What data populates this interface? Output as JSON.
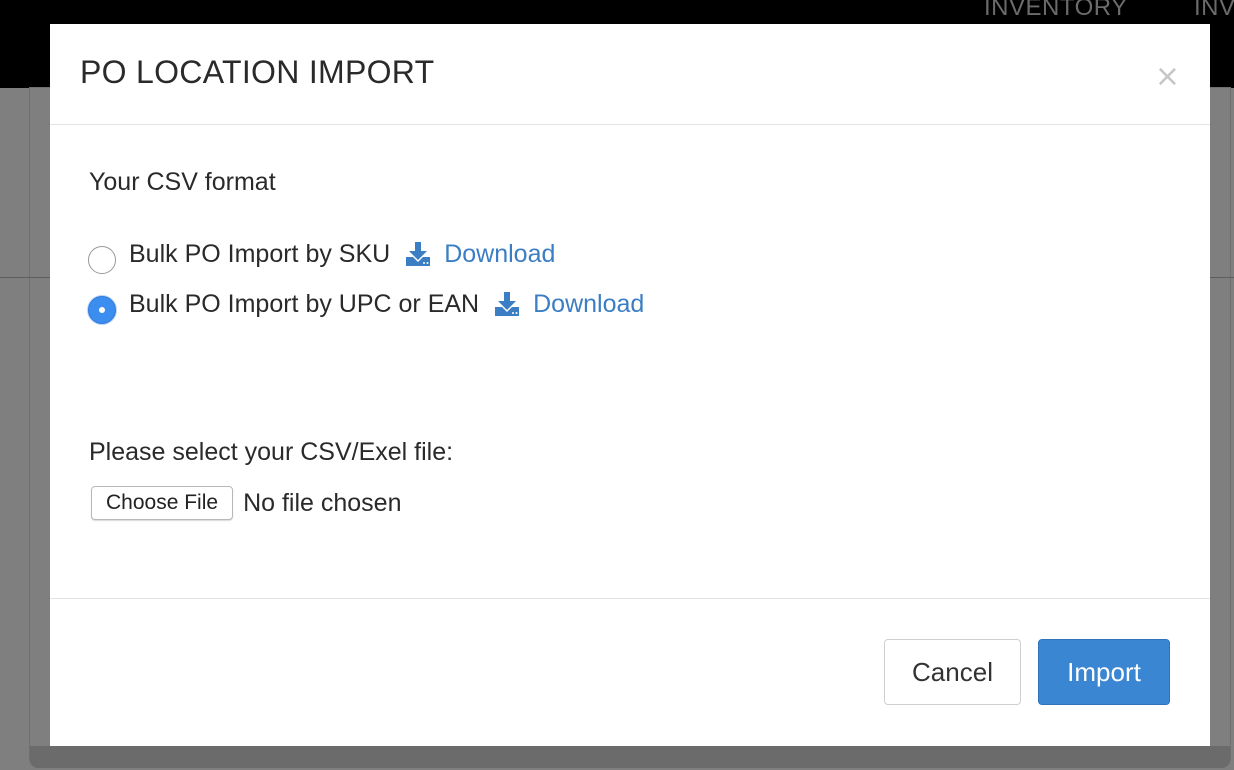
{
  "background": {
    "nav": [
      "INVENTORY",
      "INV"
    ]
  },
  "modal": {
    "title": "PO LOCATION IMPORT",
    "close_glyph": "×",
    "section_label": "Your CSV format",
    "options": [
      {
        "label": "Bulk PO Import by SKU",
        "download_label": "Download",
        "selected": false
      },
      {
        "label": "Bulk PO Import by UPC or EAN",
        "download_label": "Download",
        "selected": true
      }
    ],
    "file_label": "Please select your CSV/Exel file:",
    "choose_file_label": "Choose File",
    "file_status": "No file chosen",
    "cancel_label": "Cancel",
    "import_label": "Import"
  },
  "colors": {
    "accent": "#3a86d2",
    "link": "#3b7ec3",
    "radio_checked": "#3c8df0"
  },
  "icons": {
    "download": "download-icon",
    "close": "close-icon"
  }
}
